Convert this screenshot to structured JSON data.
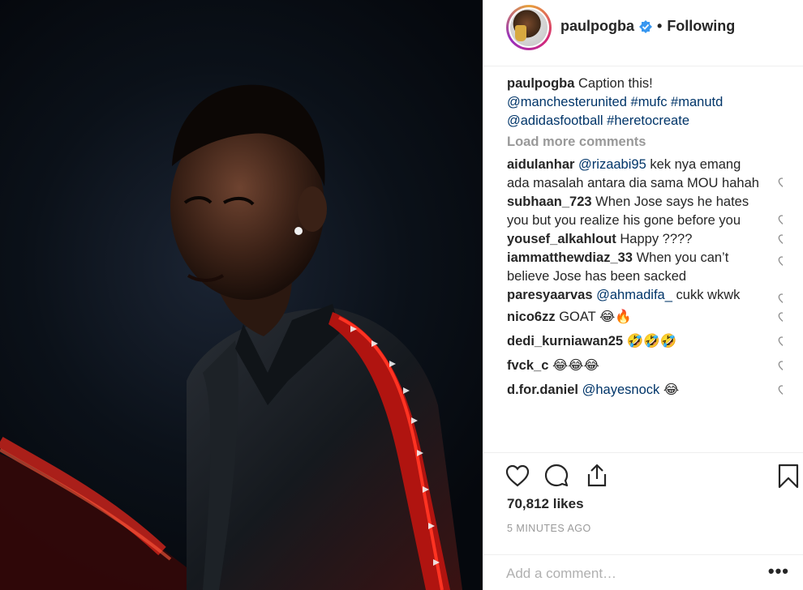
{
  "header": {
    "username": "paulpogba",
    "separator": "•",
    "follow_status": "Following"
  },
  "caption": {
    "username": "paulpogba",
    "text": "Caption this!",
    "tags": [
      "@manchesterunited",
      "#mufc",
      "#manutd",
      "@adidasfootball",
      "#heretocreate"
    ]
  },
  "load_more": "Load more comments",
  "comments": [
    {
      "user": "aidulanhar",
      "mention": "@rizaabi95",
      "text": "kek nya emang ada masalah antara dia sama MOU hahah"
    },
    {
      "user": "subhaan_723",
      "mention": "",
      "text": "When Jose says he hates you but you realize his gone before you"
    },
    {
      "user": "yousef_alkahlout",
      "mention": "",
      "text": "Happy ????"
    },
    {
      "user": "iammatthewdiaz_33",
      "mention": "",
      "text": "When you can’t believe Jose has been sacked"
    },
    {
      "user": "paresyaarvas",
      "mention": "@ahmadifa_",
      "text": "cukk wkwk"
    },
    {
      "user": "nico6zz",
      "mention": "",
      "text": "GOAT 😂🔥"
    },
    {
      "user": "dedi_kurniawan25",
      "mention": "",
      "text": "🤣🤣🤣"
    },
    {
      "user": "fvck_c",
      "mention": "",
      "text": "😂😂😂"
    },
    {
      "user": "d.for.daniel",
      "mention": "@hayesnock",
      "text": "😂"
    }
  ],
  "likes": "70,812 likes",
  "time": "5 MINUTES AGO",
  "add_comment": {
    "placeholder": "Add a comment…"
  },
  "more_label": "•••",
  "icons": {
    "verified": "verified-badge-icon",
    "like": "heart-icon",
    "comment": "comment-icon",
    "share": "share-icon",
    "save": "bookmark-icon",
    "more": "more-options-icon"
  },
  "colors": {
    "verified": "#3897f0",
    "tag": "#003569",
    "muted": "#999999",
    "jacket_stripe": "#e3201b"
  }
}
